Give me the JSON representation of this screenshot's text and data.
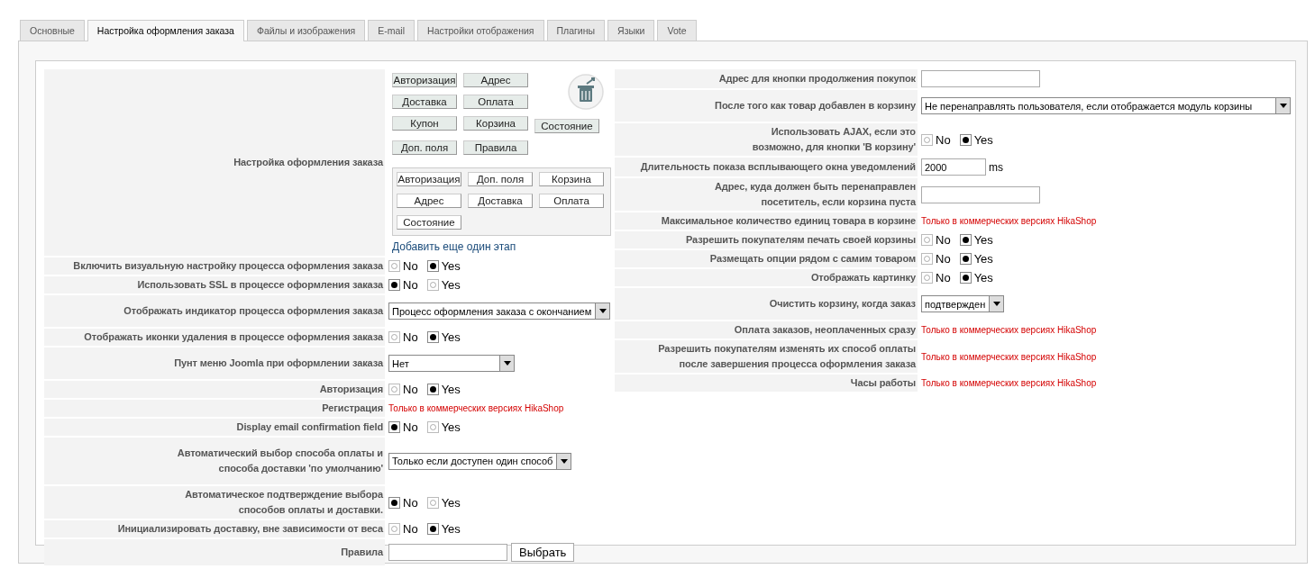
{
  "tabs": [
    {
      "label": "Основные",
      "selected": false
    },
    {
      "label": "Настройка оформления заказа",
      "selected": true
    },
    {
      "label": "Файлы и изображения",
      "selected": false
    },
    {
      "label": "E-mail",
      "selected": false
    },
    {
      "label": "Настройки отображения",
      "selected": false
    },
    {
      "label": "Плагины",
      "selected": false
    },
    {
      "label": "Языки",
      "selected": false
    },
    {
      "label": "Vote",
      "selected": false
    }
  ],
  "left_rows": [
    {
      "kind": "steps",
      "label": "Настройка оформления заказа",
      "available_steps": [
        [
          "Авторизация",
          "Адрес"
        ],
        [
          "Доставка",
          "Оплата"
        ],
        [
          "Купон",
          "Корзина",
          "Состояние"
        ],
        [
          "Доп. поля",
          "Правила"
        ]
      ],
      "current_steps": [
        [
          "Авторизация",
          "Доп. поля",
          "Корзина"
        ],
        [
          "Адрес",
          "Доставка",
          "Оплата"
        ],
        [
          "Состояние"
        ]
      ],
      "add_link": "Добавить еще один этап"
    },
    {
      "kind": "radio",
      "label": "Включить визуальную настройку процесса оформления заказа",
      "options": [
        {
          "label": "No",
          "selected": false
        },
        {
          "label": "Yes",
          "selected": true
        }
      ]
    },
    {
      "kind": "radio",
      "label": "Использовать SSL в процессе оформления заказа",
      "options": [
        {
          "label": "No",
          "selected": true
        },
        {
          "label": "Yes",
          "selected": false
        }
      ]
    },
    {
      "kind": "select",
      "label": "Отображать индикатор процесса оформления заказа",
      "value": "Процесс оформления заказа с окончанием"
    },
    {
      "kind": "radio",
      "label": "Отображать иконки удаления в процессе оформления заказа",
      "options": [
        {
          "label": "No",
          "selected": false
        },
        {
          "label": "Yes",
          "selected": true
        }
      ]
    },
    {
      "kind": "select",
      "label": "Пунт меню Joomla при оформлении заказа",
      "value": "Нет",
      "wide": true
    },
    {
      "kind": "radio",
      "label": "Авторизация",
      "options": [
        {
          "label": "No",
          "selected": false
        },
        {
          "label": "Yes",
          "selected": true
        }
      ]
    },
    {
      "kind": "commercial",
      "label": "Регистрация",
      "note": "Только в коммерческих версиях HikaShop"
    },
    {
      "kind": "radio",
      "label": "Display email confirmation field",
      "options": [
        {
          "label": "No",
          "selected": true
        },
        {
          "label": "Yes",
          "selected": false
        }
      ]
    },
    {
      "kind": "select",
      "label": "Автоматический выбор способа оплаты и\nспособа доставки 'по умолчанию'",
      "value": "Только если доступен один способ"
    },
    {
      "kind": "radio",
      "label": "Автоматическое подтверждение выбора\nспособов оплаты и доставки.",
      "options": [
        {
          "label": "No",
          "selected": true
        },
        {
          "label": "Yes",
          "selected": false
        }
      ]
    },
    {
      "kind": "radio",
      "label": "Инициализировать доставку, вне зависимости от веса",
      "options": [
        {
          "label": "No",
          "selected": false
        },
        {
          "label": "Yes",
          "selected": true
        }
      ]
    },
    {
      "kind": "text_button",
      "label": "Правила",
      "button": "Выбрать"
    }
  ],
  "right_rows": [
    {
      "kind": "text",
      "label": "Адрес для кнопки продолжения покупок"
    },
    {
      "kind": "select",
      "label": "После того как товар добавлен в корзину",
      "value": "Не перенаправлять пользователя, если отображается модуль корзины",
      "wide": true
    },
    {
      "kind": "radio",
      "label": "Использовать AJAX, если это\nвозможно, для кнопки 'В корзину'",
      "options": [
        {
          "label": "No",
          "selected": false
        },
        {
          "label": "Yes",
          "selected": true
        }
      ]
    },
    {
      "kind": "text",
      "label": "Длительность показа всплывающего окна уведомлений",
      "value": "2000",
      "unit": "ms"
    },
    {
      "kind": "text",
      "label": "Адрес, куда должен быть перенаправлен\nпосетитель, если корзина пуста"
    },
    {
      "kind": "commercial",
      "label": "Максимальное количество единиц товара в корзине",
      "note": "Только в коммерческих версиях HikaShop"
    },
    {
      "kind": "radio",
      "label": "Разрешить покупателям печать своей корзины",
      "options": [
        {
          "label": "No",
          "selected": false
        },
        {
          "label": "Yes",
          "selected": true
        }
      ]
    },
    {
      "kind": "radio",
      "label": "Размещать опции рядом с самим товаром",
      "options": [
        {
          "label": "No",
          "selected": false
        },
        {
          "label": "Yes",
          "selected": true
        }
      ]
    },
    {
      "kind": "radio",
      "label": "Отображать картинку",
      "options": [
        {
          "label": "No",
          "selected": false
        },
        {
          "label": "Yes",
          "selected": true
        }
      ]
    },
    {
      "kind": "select",
      "label": "Очистить корзину, когда заказ",
      "value": "подтвержден"
    },
    {
      "kind": "commercial",
      "label": "Оплата заказов, неоплаченных сразу",
      "note": "Только в коммерческих версиях HikaShop"
    },
    {
      "kind": "commercial",
      "label": "Разрешить покупателям изменять их способ оплаты\nпосле завершения процесса оформления заказа",
      "note": "Только в коммерческих версиях HikaShop"
    },
    {
      "kind": "commercial",
      "label": "Часы работы",
      "note": "Только в коммерческих версиях HikaShop"
    }
  ]
}
